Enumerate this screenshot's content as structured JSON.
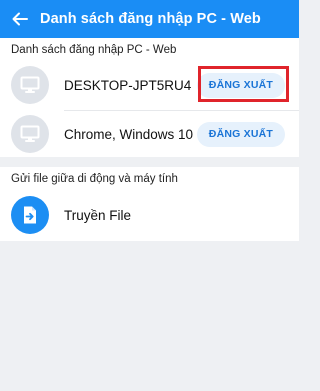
{
  "header": {
    "title": "Danh sách đăng nhập PC - Web",
    "background": "#1a8df5"
  },
  "sessions": {
    "section_label": "Danh sách đăng nhập PC - Web",
    "items": [
      {
        "device": "DESKTOP-JPT5RU4",
        "button": "ĐĂNG XUẤT",
        "icon": "monitor-icon",
        "highlighted": true
      },
      {
        "device": "Chrome, Windows 10",
        "button": "ĐĂNG XUẤT",
        "icon": "monitor-icon",
        "highlighted": false
      }
    ]
  },
  "file_transfer": {
    "section_label": "Gửi file giữa di động và máy tính",
    "item_label": "Truyền File",
    "icon": "file-transfer-icon"
  },
  "colors": {
    "accent": "#1a8df5",
    "highlight_border": "#e0242b",
    "button_bg": "#e6f1fc",
    "button_text": "#1a74d6"
  }
}
